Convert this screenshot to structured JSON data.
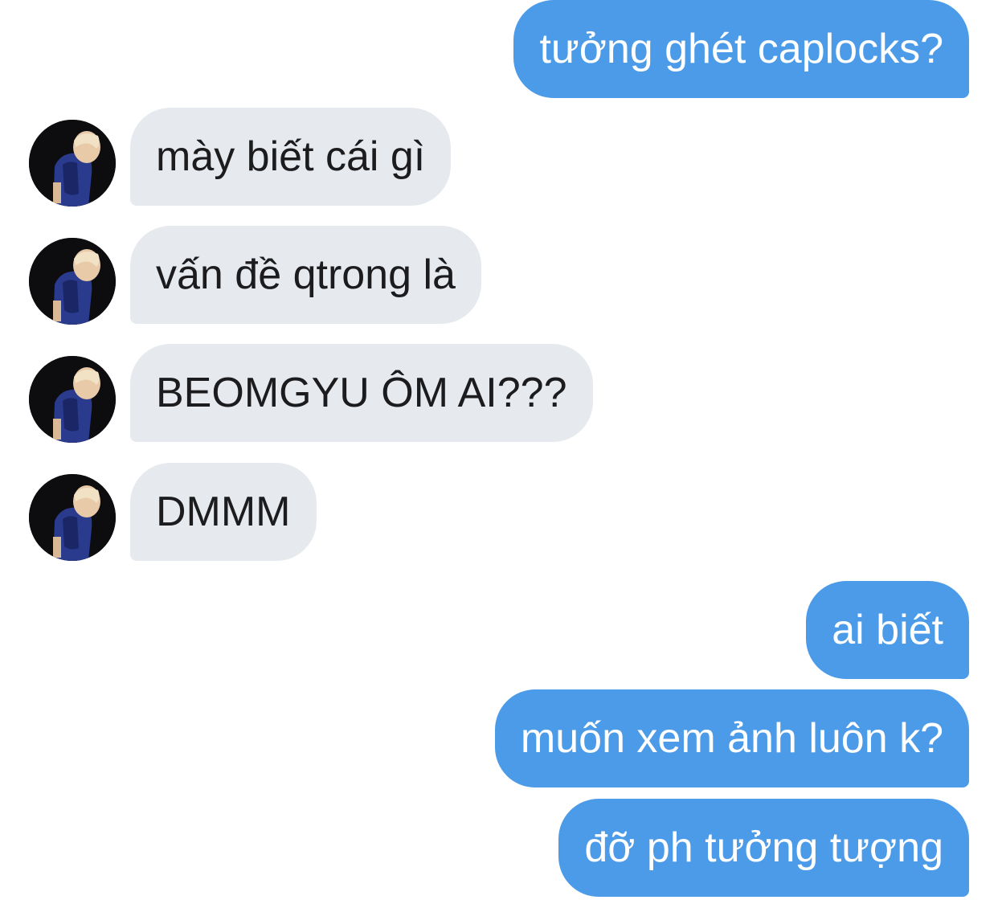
{
  "conversation": {
    "messages": [
      {
        "direction": "sent",
        "text": "tưởng ghét caplocks?"
      },
      {
        "direction": "received",
        "text": "mày biết cái gì"
      },
      {
        "direction": "received",
        "text": "vấn đề qtrong là"
      },
      {
        "direction": "received",
        "text": "BEOMGYU ÔM AI???"
      },
      {
        "direction": "received",
        "text": "DMMM"
      },
      {
        "direction": "sent",
        "text": "ai biết"
      },
      {
        "direction": "sent",
        "text": "muốn xem ảnh luôn k?"
      },
      {
        "direction": "sent",
        "text": "đỡ ph tưởng tượng"
      }
    ]
  },
  "colors": {
    "sent_bubble": "#4c9be8",
    "received_bubble": "#e6e9ee",
    "sent_text": "#ffffff",
    "received_text": "#1c1c1e"
  },
  "icons": {
    "sender_avatar": "avatar-photo"
  }
}
